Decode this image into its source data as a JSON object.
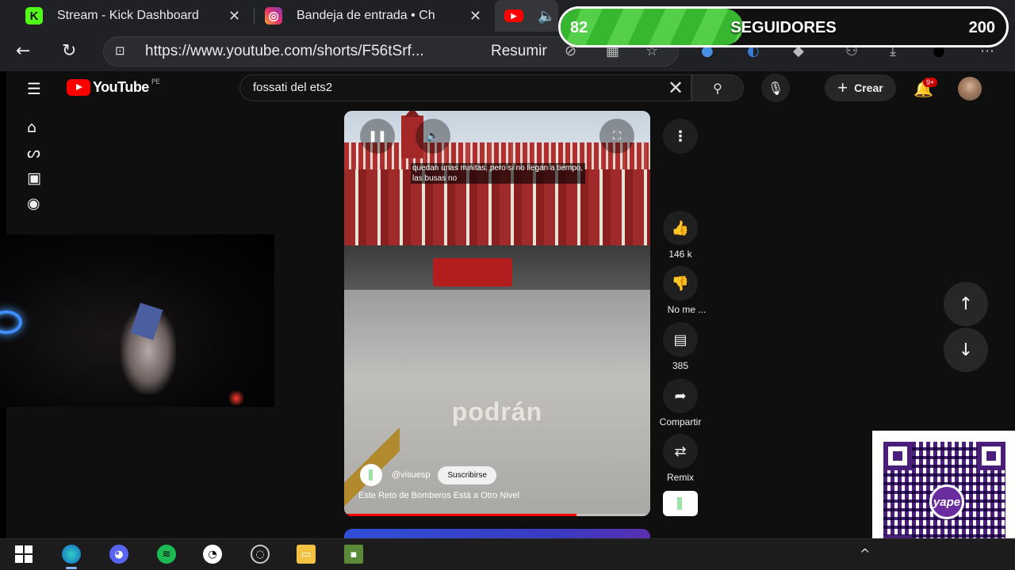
{
  "browser": {
    "tabs": [
      {
        "title": "Stream - Kick Dashboard",
        "favicon": "kick-icon"
      },
      {
        "title": "Bandeja de entrada • Ch",
        "favicon": "instagram-icon"
      },
      {
        "title": "",
        "favicon": "youtube-icon"
      }
    ],
    "url": "https://www.youtube.com/shorts/F56tSrf...",
    "resumir_label": "Resumir"
  },
  "youtube": {
    "logo_text": "YouTube",
    "country_code": "PE",
    "search_value": "fossati del ets2",
    "create_label": "Crear",
    "notification_count": "9+",
    "sidebar": [
      {
        "icon": "home-icon"
      },
      {
        "icon": "shorts-icon"
      },
      {
        "icon": "subscriptions-icon"
      },
      {
        "icon": "you-icon"
      }
    ]
  },
  "short": {
    "caption": "quedan unas minitas, pero si no llegan a tiempo, las busas no",
    "overlay_word": "podrán",
    "channel": "@visuesp",
    "subscribe_label": "Suscribirse",
    "title": "Este Reto de Bomberos Está a Otro Nivel",
    "progress": 0.76
  },
  "actions": {
    "likes": "146 k",
    "dislike_label": "No me ...",
    "comments": "385",
    "share_label": "Compartir",
    "remix_label": "Remix"
  },
  "followers_goal": {
    "current": "82",
    "label": "SEGUIDORES",
    "target": "200",
    "fill_fraction": 0.41,
    "color": "#3dbd35"
  },
  "qr": {
    "logo_text": "yape",
    "accent": "#4a1f7a"
  },
  "taskbar": {
    "items": [
      "windows-start-icon",
      "edge-icon",
      "discord-icon",
      "spotify-icon",
      "clock-app-icon",
      "obs-icon",
      "file-explorer-icon",
      "minecraft-icon"
    ]
  }
}
